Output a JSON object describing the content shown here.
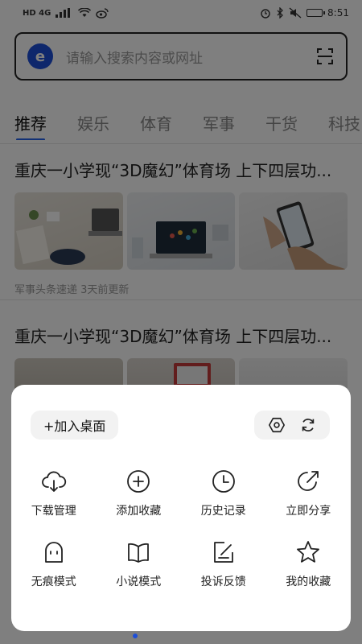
{
  "status_bar": {
    "left": "HD 4G",
    "time": "8:51"
  },
  "search": {
    "logo": "e",
    "placeholder": "请输入搜索内容或网址"
  },
  "tabs": [
    {
      "label": "推荐"
    },
    {
      "label": "娱乐"
    },
    {
      "label": "体育"
    },
    {
      "label": "军事"
    },
    {
      "label": "干货"
    },
    {
      "label": "科技"
    }
  ],
  "feed": [
    {
      "title": "重庆一小学现“3D魔幻”体育场 上下四层功...",
      "meta": "军事头条速递 3天前更新"
    },
    {
      "title": "重庆一小学现“3D魔幻”体育场 上下四层功..."
    }
  ],
  "sheet": {
    "add_to_desktop": "+加入桌面",
    "tools": [
      "settings-icon",
      "refresh-icon"
    ],
    "items": [
      {
        "label": "下载管理",
        "icon": "cloud-download-icon"
      },
      {
        "label": "添加收藏",
        "icon": "plus-circle-icon"
      },
      {
        "label": "历史记录",
        "icon": "clock-icon"
      },
      {
        "label": "立即分享",
        "icon": "share-icon"
      },
      {
        "label": "无痕模式",
        "icon": "ghost-icon"
      },
      {
        "label": "小说模式",
        "icon": "book-icon"
      },
      {
        "label": "投诉反馈",
        "icon": "feedback-icon"
      },
      {
        "label": "我的收藏",
        "icon": "star-icon"
      }
    ]
  },
  "colors": {
    "accent": "#2563eb",
    "logo_bg": "#1d4ed8"
  }
}
